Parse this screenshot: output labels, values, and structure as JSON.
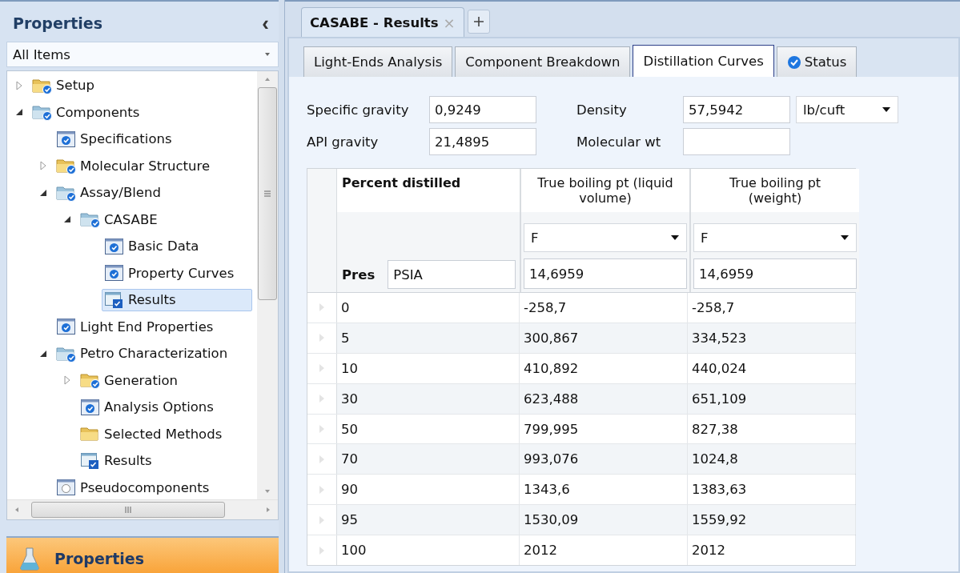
{
  "sidebar": {
    "title": "Properties",
    "collapse_glyph": "‹",
    "filter": {
      "value": "All Items"
    },
    "tree": [
      {
        "label": "Setup",
        "kind": "folder-check",
        "expanded": false,
        "selected": false
      },
      {
        "label": "Components",
        "kind": "folder-open",
        "expanded": true,
        "selected": false,
        "children": [
          {
            "label": "Specifications",
            "kind": "form",
            "selected": false
          },
          {
            "label": "Molecular Structure",
            "kind": "folder-check",
            "expanded": false,
            "selected": false
          },
          {
            "label": "Assay/Blend",
            "kind": "folder-open",
            "expanded": true,
            "selected": false,
            "children": [
              {
                "label": "CASABE",
                "kind": "folder-open",
                "expanded": true,
                "selected": false,
                "children": [
                  {
                    "label": "Basic Data",
                    "kind": "form",
                    "selected": false
                  },
                  {
                    "label": "Property Curves",
                    "kind": "form",
                    "selected": false
                  },
                  {
                    "label": "Results",
                    "kind": "results",
                    "selected": true
                  }
                ]
              }
            ]
          },
          {
            "label": "Light End Properties",
            "kind": "form",
            "selected": false
          },
          {
            "label": "Petro Characterization",
            "kind": "folder-open",
            "expanded": true,
            "selected": false,
            "children": [
              {
                "label": "Generation",
                "kind": "folder-check",
                "expanded": false,
                "selected": false
              },
              {
                "label": "Analysis Options",
                "kind": "form",
                "selected": false
              },
              {
                "label": "Selected Methods",
                "kind": "folder",
                "selected": false
              },
              {
                "label": "Results",
                "kind": "results",
                "selected": false
              }
            ]
          },
          {
            "label": "Pseudocomponents",
            "kind": "form-empty",
            "selected": false
          }
        ]
      }
    ],
    "footer": {
      "label": "Properties"
    }
  },
  "document_tabs": [
    {
      "label": "CASABE - Results",
      "close_glyph": "×"
    }
  ],
  "tabs": [
    {
      "label": "Light-Ends Analysis",
      "kind": "plain",
      "selected": false
    },
    {
      "label": "Component Breakdown",
      "kind": "plain",
      "selected": false
    },
    {
      "label": "Distillation Curves",
      "kind": "plain",
      "selected": true
    },
    {
      "label": "Status",
      "kind": "status",
      "selected": false
    }
  ],
  "fields_left": [
    {
      "label": "Specific gravity",
      "value": "0,9249"
    },
    {
      "label": "API gravity",
      "value": "21,4895"
    }
  ],
  "fields_right": [
    {
      "label": "Density",
      "value": "57,5942",
      "unit": "lb/cuft"
    },
    {
      "label": "Molecular wt"
    }
  ],
  "grid": {
    "pressure_label": "Pres",
    "pressure_unit": "PSIA",
    "columns": [
      {
        "header": "Percent distilled"
      },
      {
        "header": "True boiling pt (liquid volume)",
        "unit": "F",
        "pressure": "14,6959"
      },
      {
        "header": "True boiling pt (weight)",
        "unit": "F",
        "pressure": "14,6959"
      }
    ],
    "rows": [
      {
        "cells": [
          "0",
          "-258,7",
          "-258,7"
        ]
      },
      {
        "cells": [
          "5",
          "300,867",
          "334,523"
        ]
      },
      {
        "cells": [
          "10",
          "410,892",
          "440,024"
        ]
      },
      {
        "cells": [
          "30",
          "623,488",
          "651,109"
        ]
      },
      {
        "cells": [
          "50",
          "799,995",
          "827,38"
        ]
      },
      {
        "cells": [
          "70",
          "993,076",
          "1024,8"
        ]
      },
      {
        "cells": [
          "90",
          "1343,6",
          "1383,63"
        ]
      },
      {
        "cells": [
          "95",
          "1530,09",
          "1559,92"
        ]
      },
      {
        "cells": [
          "100",
          "2012",
          "2012"
        ]
      }
    ]
  }
}
